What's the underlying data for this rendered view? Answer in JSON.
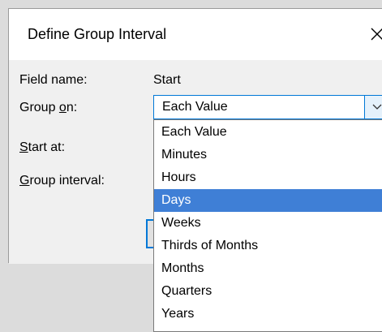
{
  "dialog": {
    "title": "Define Group Interval",
    "close_glyph": "X"
  },
  "fields": {
    "field_name_label": "Field name:",
    "field_name_value": "Start",
    "group_on_label_pre": "Group ",
    "group_on_label_u": "o",
    "group_on_label_post": "n:",
    "start_at_label_u": "S",
    "start_at_label_post": "tart at:",
    "group_interval_label_u": "G",
    "group_interval_label_post": "roup interval:"
  },
  "combo": {
    "selected_value": "Each Value",
    "arrow_icon": "chevron-down-icon"
  },
  "dropdown": {
    "options": [
      "Each Value",
      "Minutes",
      "Hours",
      "Days",
      "Weeks",
      "Thirds of Months",
      "Months",
      "Quarters",
      "Years"
    ],
    "highlighted": "Days"
  },
  "colors": {
    "accent": "#0078d7",
    "highlight": "#3f7fd6",
    "dialog_body": "#f0f0f0",
    "backdrop": "#dcdcdc"
  }
}
